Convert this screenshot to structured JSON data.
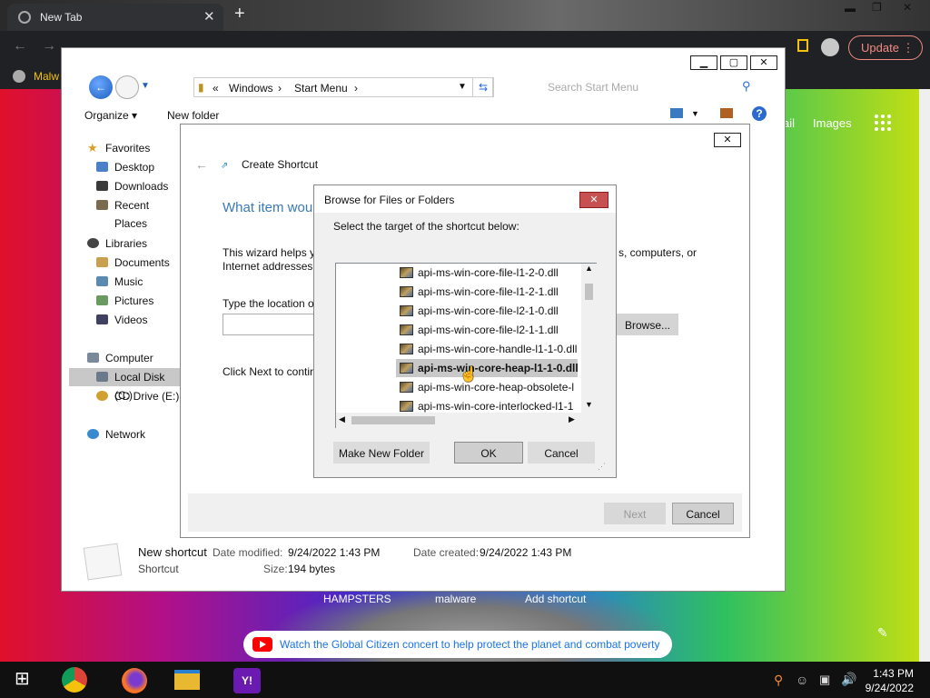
{
  "browser": {
    "tab_title": "New Tab",
    "update_label": "Update",
    "bookmark_label": "Malw",
    "gmail_label": "ail",
    "images_label": "Images"
  },
  "newtab": {
    "shortcuts": [
      "HAMPSTERS",
      "malware",
      "Add shortcut"
    ],
    "banner": "Watch the Global Citizen concert to help protect the planet and combat poverty"
  },
  "explorer": {
    "breadcrumb": [
      "«",
      "Windows",
      "Start Menu"
    ],
    "search_placeholder": "Search Start Menu",
    "organize": "Organize",
    "new_folder": "New folder",
    "nav": {
      "favorites": "Favorites",
      "desktop": "Desktop",
      "downloads": "Downloads",
      "recent": "Recent Places",
      "libraries": "Libraries",
      "documents": "Documents",
      "music": "Music",
      "pictures": "Pictures",
      "videos": "Videos",
      "computer": "Computer",
      "local_disk": "Local Disk (C:)",
      "cd_drive": "CD Drive (E:)",
      "network": "Network"
    },
    "details": {
      "name": "New shortcut",
      "type": "Shortcut",
      "modified_label": "Date modified:",
      "modified_value": "9/24/2022 1:43 PM",
      "created_label": "Date created:",
      "created_value": "9/24/2022 1:43 PM",
      "size_label": "Size:",
      "size_value": "194 bytes"
    }
  },
  "wizard": {
    "title": "Create Shortcut",
    "heading": "What item wou",
    "intro_1": "This wizard helps y",
    "intro_1_tail": "s, computers, or",
    "intro_2": "Internet addresses.",
    "location_label": "Type the location o",
    "location_value": "",
    "browse_label": "Browse...",
    "click_next": "Click Next to contir",
    "next_label": "Next",
    "cancel_label": "Cancel"
  },
  "browse": {
    "title": "Browse for Files or Folders",
    "prompt": "Select the target of the shortcut below:",
    "files": [
      "api-ms-win-core-file-l1-2-0.dll",
      "api-ms-win-core-file-l1-2-1.dll",
      "api-ms-win-core-file-l2-1-0.dll",
      "api-ms-win-core-file-l2-1-1.dll",
      "api-ms-win-core-handle-l1-1-0.dll",
      "api-ms-win-core-heap-l1-1-0.dll",
      "api-ms-win-core-heap-obsolete-l",
      "api-ms-win-core-interlocked-l1-1"
    ],
    "selected_index": 5,
    "make_folder_label": "Make New Folder",
    "ok_label": "OK",
    "cancel_label": "Cancel"
  },
  "taskbar": {
    "time": "1:43 PM",
    "date": "9/24/2022"
  }
}
